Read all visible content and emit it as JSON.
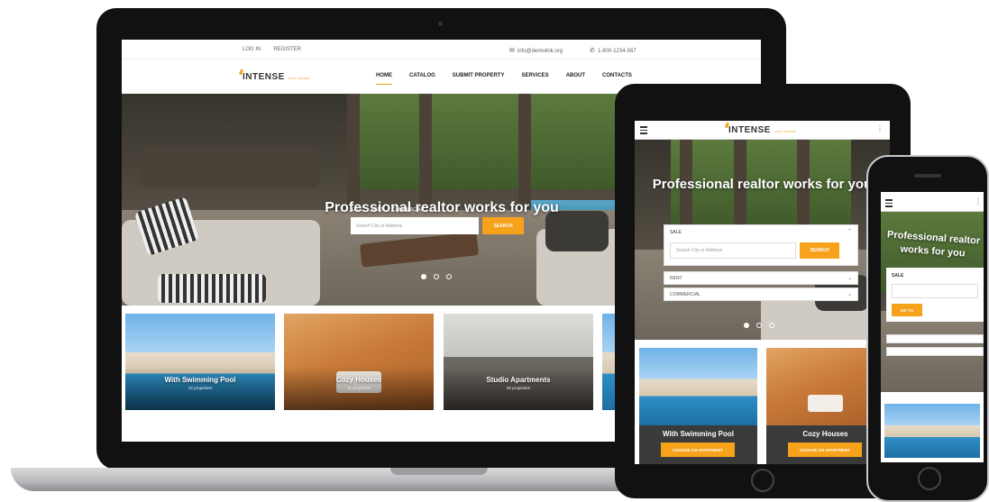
{
  "brand": {
    "name": "INTENSE",
    "tagline": "real estate",
    "accent": "#f7a21b"
  },
  "topbar": {
    "login": "LOG IN",
    "register": "REGISTER",
    "email": "info@demolink.org",
    "phone": "1-800-1234-567"
  },
  "nav": {
    "items": [
      "HOME",
      "CATALOG",
      "SUBMIT PROPERTY",
      "SERVICES",
      "ABOUT",
      "CONTACTS"
    ],
    "active": "HOME"
  },
  "hero": {
    "title": "Professional realtor works for you",
    "tabs": [
      "SALE",
      "RENT",
      "COMMERCIAL"
    ],
    "search_placeholder": "Search City or Address",
    "search_button": "SEARCH"
  },
  "categories": [
    {
      "title": "With Swimming Pool",
      "count": "32 properties",
      "cta": "CHOOSE AN APARTMENT"
    },
    {
      "title": "Cozy Houses",
      "count": "16 properties",
      "cta": "CHOOSE AN APARTMENT"
    },
    {
      "title": "Studio Apartments",
      "count": "30 properties"
    }
  ],
  "phone": {
    "title": "Professional realtor works for you",
    "select_label": "SALE",
    "button": "GO TO"
  },
  "icons": {
    "menu": "hamburger-icon",
    "more": "kebab-icon",
    "mail": "mail-icon",
    "phone": "phone-icon"
  }
}
